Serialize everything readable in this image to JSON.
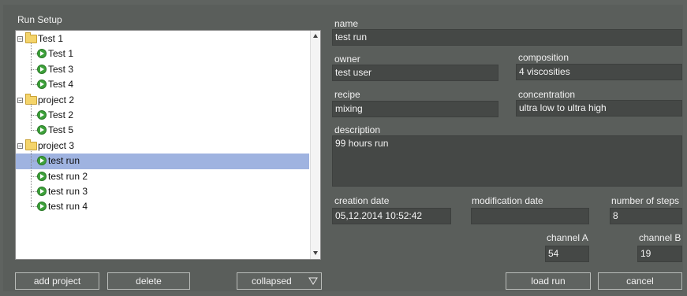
{
  "panel": {
    "title": "Run Setup"
  },
  "tree": [
    {
      "label": "Test 1",
      "kind": "project",
      "level": 0
    },
    {
      "label": "Test 1",
      "kind": "run",
      "level": 1
    },
    {
      "label": "Test 3",
      "kind": "run",
      "level": 1
    },
    {
      "label": "Test 4",
      "kind": "run",
      "level": 1
    },
    {
      "label": "project 2",
      "kind": "project",
      "level": 0
    },
    {
      "label": "Test 2",
      "kind": "run",
      "level": 1
    },
    {
      "label": "Test 5",
      "kind": "run",
      "level": 1
    },
    {
      "label": "project 3",
      "kind": "project",
      "level": 0
    },
    {
      "label": "test run",
      "kind": "run",
      "level": 1,
      "selected": true
    },
    {
      "label": "test run 2",
      "kind": "run",
      "level": 1
    },
    {
      "label": "test run 3",
      "kind": "run",
      "level": 1
    },
    {
      "label": "test run 4",
      "kind": "run",
      "level": 1
    }
  ],
  "buttons": {
    "add_project": "add project",
    "delete": "delete",
    "collapsed": "collapsed",
    "load_run": "load run",
    "cancel": "cancel"
  },
  "form": {
    "name": {
      "label": "name",
      "value": "test run"
    },
    "owner": {
      "label": "owner",
      "value": "test user"
    },
    "composition": {
      "label": "composition",
      "value": "4 viscosities"
    },
    "recipe": {
      "label": "recipe",
      "value": "mixing"
    },
    "concentration": {
      "label": "concentration",
      "value": "ultra low to ultra high"
    },
    "description": {
      "label": "description",
      "value": "99 hours run"
    },
    "creation_date": {
      "label": "creation date",
      "value": "05,12.2014 10:52:42"
    },
    "modification_date": {
      "label": "modification date",
      "value": ""
    },
    "number_of_steps": {
      "label": "number of steps",
      "value": "8"
    },
    "channel_a": {
      "label": "channel A",
      "value": "54"
    },
    "channel_b": {
      "label": "channel B",
      "value": "19"
    }
  },
  "colors": {
    "background": "#5f6360",
    "field": "#454846",
    "selection": "#9fb3e0",
    "run_icon": "#3da13a",
    "folder": "#f4d46b"
  }
}
